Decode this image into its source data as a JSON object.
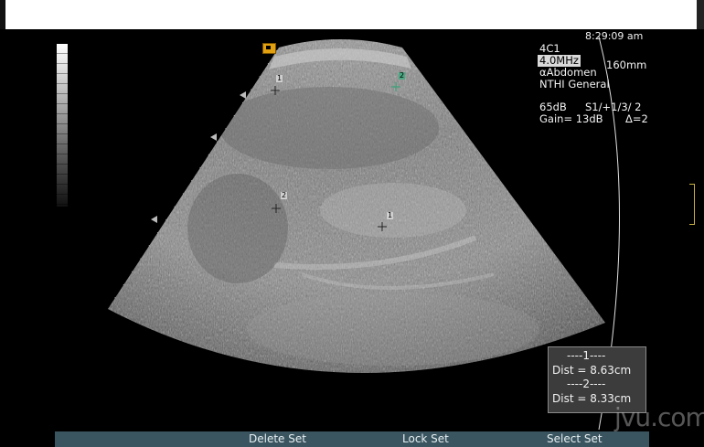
{
  "clock": "8:29:09 am",
  "probe": {
    "model": "4C1",
    "frequency": "4.0MHz",
    "depth": "160mm",
    "preset": "αAbdomen",
    "institution": "NTHI General"
  },
  "imaging": {
    "dynamic_range": "65dB",
    "map": "S1/+1/3/ 2",
    "gain": "Gain= 13dB",
    "delta": "Δ=2"
  },
  "calipers": [
    {
      "id": "1",
      "header": "----1----",
      "distance": "Dist = 8.63cm"
    },
    {
      "id": "2",
      "header": "----2----",
      "distance": "Dist = 8.33cm"
    }
  ],
  "caliper_markers": [
    "1",
    "2",
    "2",
    "1"
  ],
  "softkeys": [
    "Delete Set",
    "Lock Set",
    "Select Set"
  ],
  "watermark": "jvu.com"
}
